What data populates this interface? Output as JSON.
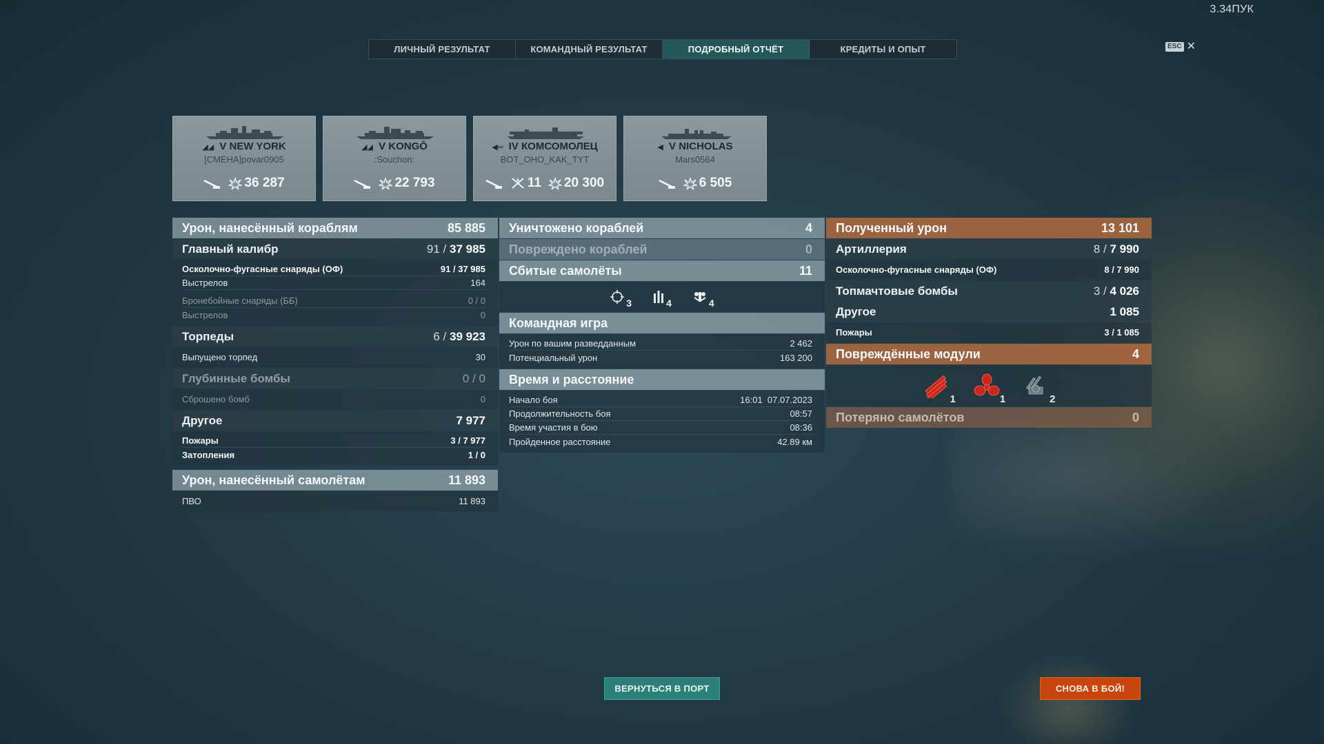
{
  "version": "3.34ПУК",
  "tabs": [
    {
      "label": "ЛИЧНЫЙ РЕЗУЛЬТАТ",
      "active": false
    },
    {
      "label": "КОМАНДНЫЙ РЕЗУЛЬТАТ",
      "active": false
    },
    {
      "label": "ПОДРОБНЫЙ ОТЧЁТ",
      "active": true
    },
    {
      "label": "КРЕДИТЫ И ОПЫТ",
      "active": false
    }
  ],
  "esc": {
    "key": "ESC",
    "close": "✕"
  },
  "ships": [
    {
      "tier": "V",
      "name": "NEW YORK",
      "player": "[СМЕНА]povar0905",
      "kills": "",
      "damage": "36 287",
      "ship_icon": "battleship-silhouette"
    },
    {
      "tier": "V",
      "name": "KONGŌ",
      "player": ":Souchon:",
      "kills": "",
      "damage": "22 793",
      "ship_icon": "battleship-silhouette"
    },
    {
      "tier": "IV",
      "name": "КОМСОМОЛЕЦ",
      "player": "BOT_OHO_KAK_TYT",
      "kills": "11",
      "damage": "20 300",
      "ship_icon": "carrier-silhouette"
    },
    {
      "tier": "V",
      "name": "NICHOLAS",
      "player": "Mars0564",
      "kills": "",
      "damage": "6 505",
      "ship_icon": "destroyer-silhouette"
    }
  ],
  "col1": {
    "title": "Урон, нанесённый кораблям",
    "title_value": "85 885",
    "main_battery": {
      "label": "Главный калибр",
      "hits": "91",
      "value": "37 985"
    },
    "he": {
      "label": "Осколочно-фугасные снаряды (ОФ)",
      "hits": "91",
      "value": "37 985"
    },
    "he_shots": {
      "label": "Выстрелов",
      "value": "164"
    },
    "ap": {
      "label": "Бронебойные снаряды (ББ)",
      "hits": "0",
      "value": "0"
    },
    "ap_shots": {
      "label": "Выстрелов",
      "value": "0"
    },
    "torpedoes": {
      "label": "Торпеды",
      "hits": "6",
      "value": "39 923"
    },
    "torp_launched": {
      "label": "Выпущено торпед",
      "value": "30"
    },
    "depth": {
      "label": "Глубинные бомбы",
      "hits": "0",
      "value": "0"
    },
    "depth_dropped": {
      "label": "Сброшено бомб",
      "value": "0"
    },
    "other": {
      "label": "Другое",
      "value": "7 977"
    },
    "fires": {
      "label": "Пожары",
      "hits": "3",
      "value": "7 977"
    },
    "floods": {
      "label": "Затопления",
      "hits": "1",
      "value": "0"
    },
    "aircraft_dmg": {
      "label": "Урон, нанесённый самолётам",
      "value": "11 893"
    },
    "aa": {
      "label": "ПВО",
      "value": "11 893"
    }
  },
  "col2": {
    "destroyed": {
      "label": "Уничтожено кораблей",
      "value": "4"
    },
    "damaged": {
      "label": "Повреждено кораблей",
      "value": "0"
    },
    "planes": {
      "label": "Сбитые самолёты",
      "value": "11"
    },
    "plane_types": [
      {
        "icon": "fighter-crosshair-icon",
        "value": "3"
      },
      {
        "icon": "torpedo-bomber-icon",
        "value": "4"
      },
      {
        "icon": "dive-bomber-icon",
        "value": "4"
      }
    ],
    "team": {
      "label": "Командная игра"
    },
    "spotting": {
      "label": "Урон по вашим разведданным",
      "value": "2 462"
    },
    "potential": {
      "label": "Потенциальный урон",
      "value": "163 200"
    },
    "time": {
      "label": "Время и расстояние"
    },
    "start": {
      "label": "Начало боя",
      "value": "16:01  07.07.2023"
    },
    "duration": {
      "label": "Продолжительность боя",
      "value": "08:57"
    },
    "alive": {
      "label": "Время участия в бою",
      "value": "08:36"
    },
    "distance": {
      "label": "Пройденное расстояние",
      "value": "42.89 км"
    }
  },
  "col3": {
    "received": {
      "label": "Полученный урон",
      "value": "13 101"
    },
    "artillery": {
      "label": "Артиллерия",
      "hits": "8",
      "value": "7 990"
    },
    "he": {
      "label": "Осколочно-фугасные снаряды (ОФ)",
      "hits": "8",
      "value": "7 990"
    },
    "skip": {
      "label": "Топмачтовые бомбы",
      "hits": "3",
      "value": "4 026"
    },
    "other": {
      "label": "Другое",
      "value": "1 085"
    },
    "fires": {
      "label": "Пожары",
      "hits": "3",
      "value": "1 085"
    },
    "modules": {
      "label": "Повреждённые модули",
      "value": "4"
    },
    "module_items": [
      {
        "icon": "torpedo-tubes-icon",
        "value": "1"
      },
      {
        "icon": "propeller-icon",
        "value": "1"
      },
      {
        "icon": "aa-gun-icon",
        "value": "2"
      }
    ],
    "lost_planes": {
      "label": "Потеряно самолётов",
      "value": "0"
    }
  },
  "buttons": {
    "port": "ВЕРНУТЬСЯ В ПОРТ",
    "battle": "СНОВА В БОЙ!"
  },
  "colors": {
    "accent_tab": "#23575a",
    "orange_header": "#b06a3e",
    "battle_button": "#c94510",
    "port_button": "#2d8079",
    "module_red": "#c8281e"
  }
}
